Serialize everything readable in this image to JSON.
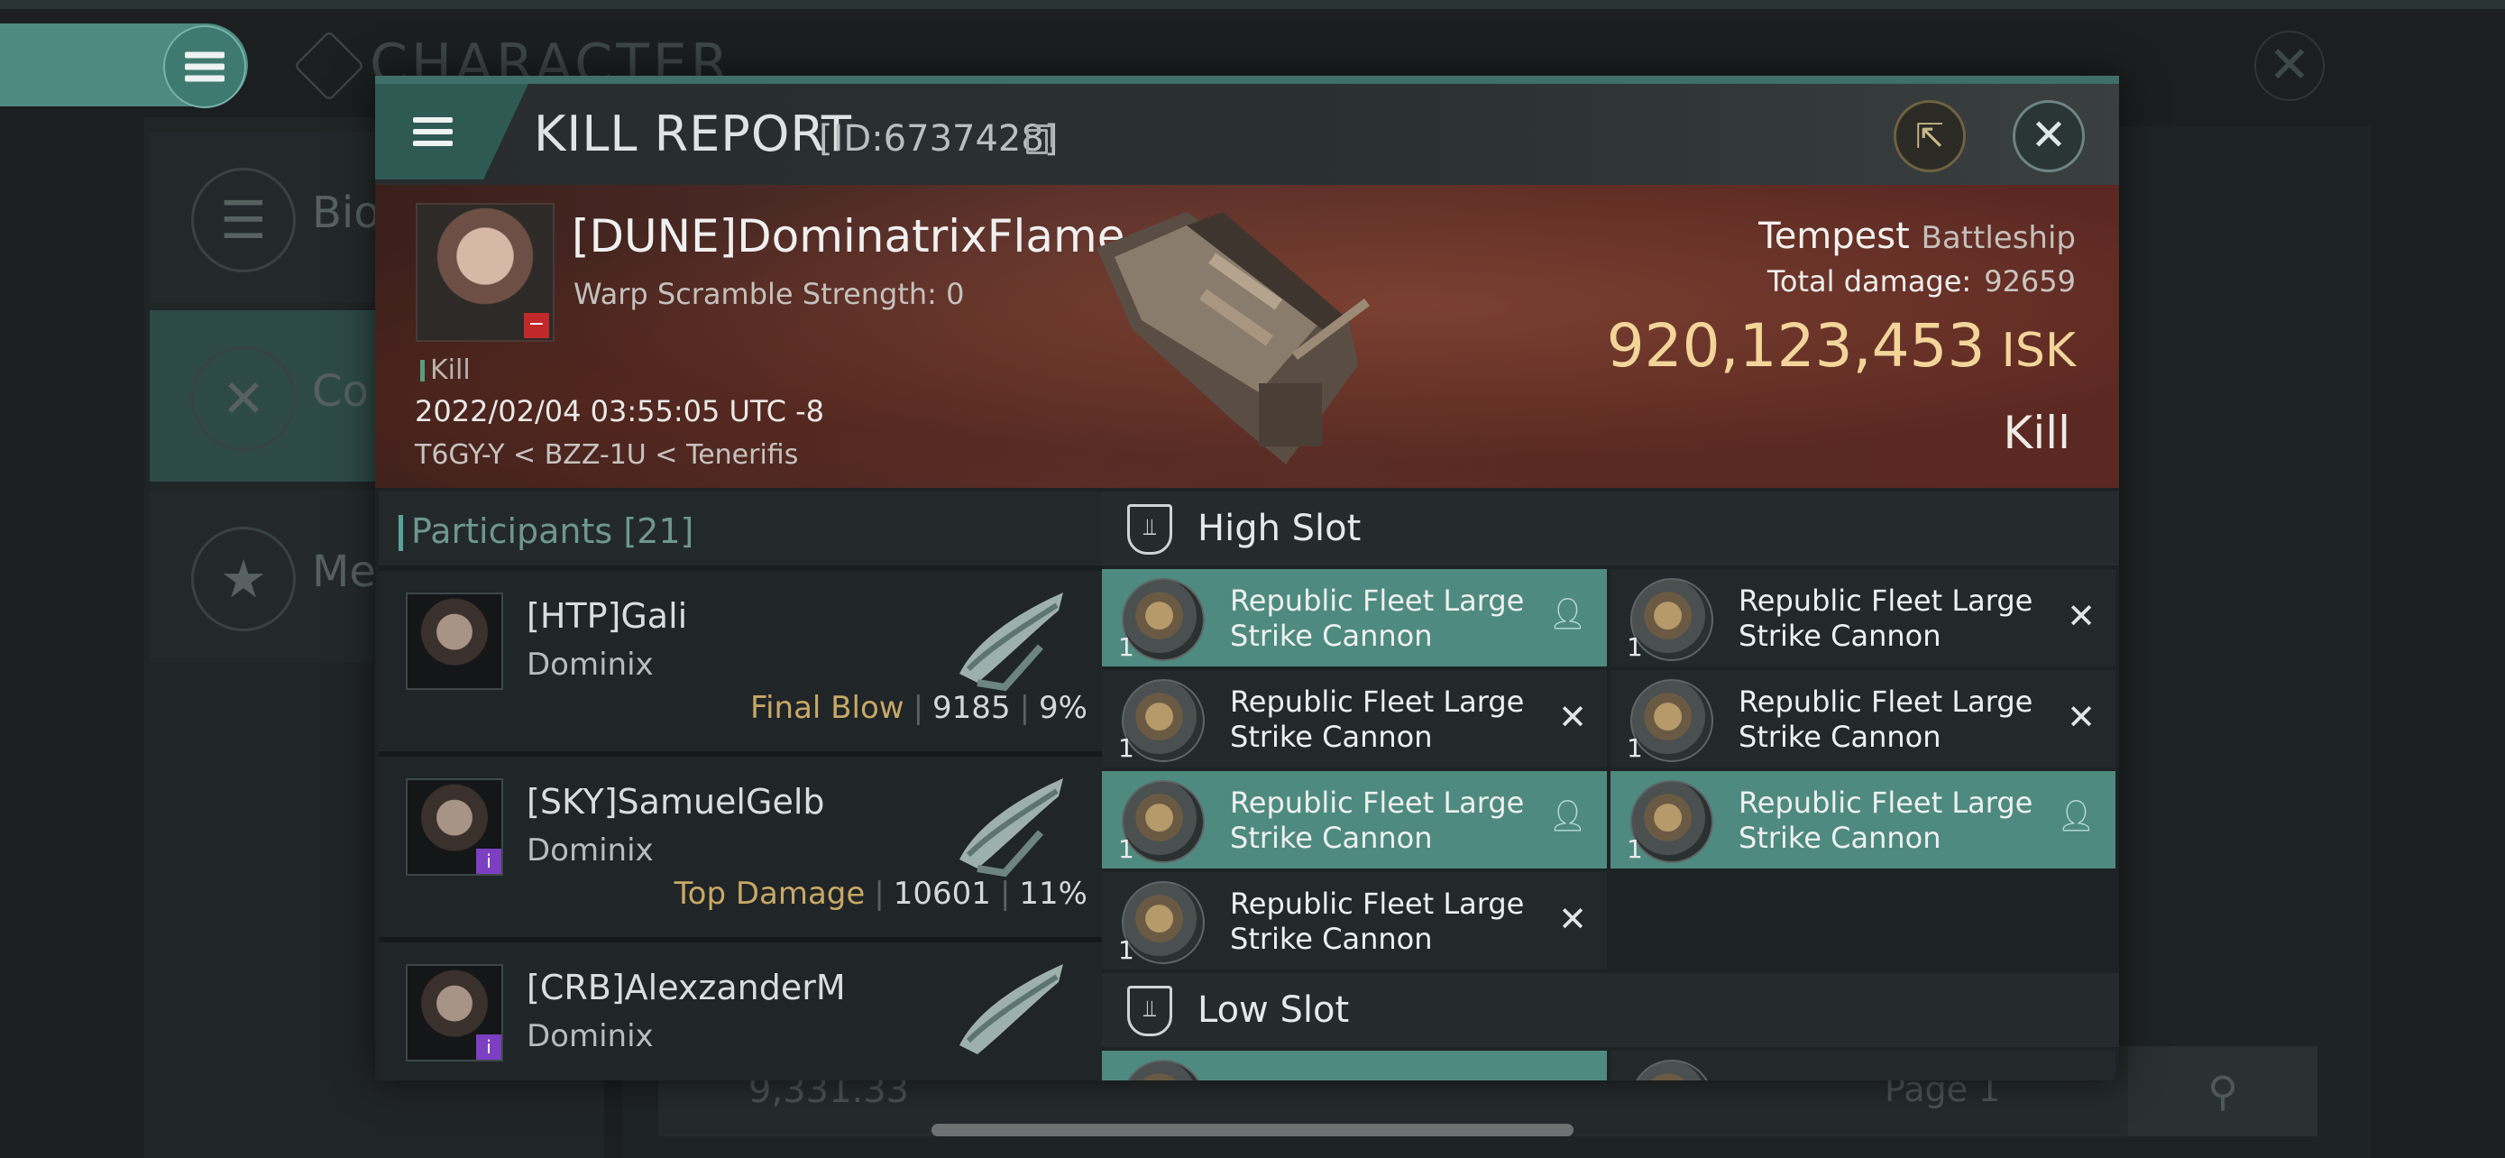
{
  "background": {
    "title": "CHARACTER",
    "menu": [
      {
        "label": "Bio",
        "icon": "list-icon"
      },
      {
        "label": "Co",
        "icon": "crossed-swords-icon"
      },
      {
        "label": "Me",
        "icon": "star-icon"
      }
    ],
    "bottom_value": "9,331.33",
    "page_label": "Page 1"
  },
  "window": {
    "title": "KILL REPORT",
    "id_label": "[ID:6737428]"
  },
  "victim": {
    "name": "[DUNE]DominatrixFlame",
    "warp": "Warp Scramble Strength: 0",
    "tag": "Kill",
    "date": "2022/02/04 03:55:05 UTC -8",
    "location": "T6GY-Y < BZZ-1U < Tenerifis",
    "ship_name": "Tempest",
    "ship_class": "Battleship",
    "total_damage_label": "Total damage:",
    "total_damage": "92659",
    "isk_value": "920,123,453",
    "isk_unit": "ISK",
    "result": "Kill"
  },
  "participants": {
    "label": "Participants",
    "count": "[21]",
    "items": [
      {
        "name": "[HTP]Gali",
        "ship": "Dominix",
        "label": "Final Blow",
        "damage": "9185",
        "percent": "9%"
      },
      {
        "name": "[SKY]SamuelGelb",
        "ship": "Dominix",
        "label": "Top Damage",
        "damage": "10601",
        "percent": "11%"
      },
      {
        "name": "[CRB]AlexzanderM",
        "ship": "Dominix"
      }
    ]
  },
  "slots": {
    "high_label": "High Slot",
    "low_label": "Low Slot",
    "module_line1": "Republic Fleet Large",
    "module_line2": "Strike Cannon",
    "qty": "1"
  },
  "colors": {
    "accent": "#4f8a80",
    "isk": "#f3d59a",
    "final_blow": "#c8a866"
  }
}
